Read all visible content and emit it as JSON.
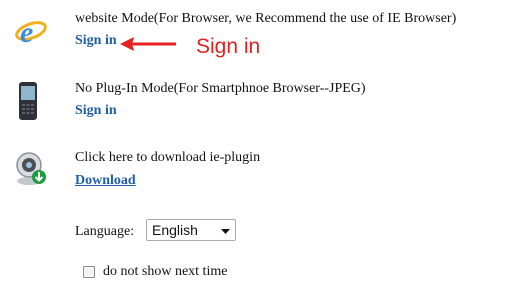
{
  "rows": {
    "website": {
      "title": "website Mode(For Browser, we Recommend the use of IE Browser)",
      "link": "Sign in",
      "icon": "ie-browser-icon"
    },
    "noplugin": {
      "title": "No Plug-In Mode(For Smartphnoe Browser--JPEG)",
      "link": "Sign in",
      "icon": "smartphone-icon"
    },
    "plugin": {
      "title": "Click here to download ie-plugin",
      "link": "Download",
      "icon": "webcam-download-icon"
    }
  },
  "annotation": {
    "label": "Sign in",
    "color": "#e62020"
  },
  "language": {
    "label": "Language:",
    "selected": "English"
  },
  "checkbox": {
    "label": "do not show next time",
    "checked": false
  },
  "colors": {
    "link": "#1f5fa8",
    "annotation": "#e62020"
  }
}
